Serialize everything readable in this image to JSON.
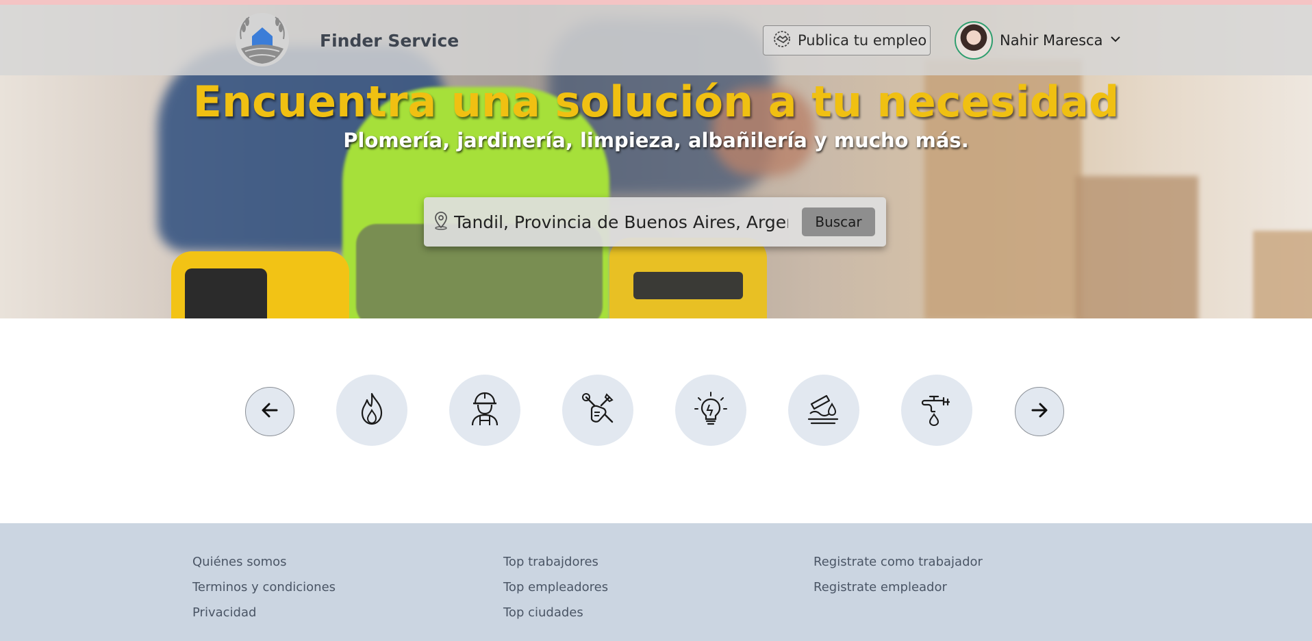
{
  "navbar": {
    "brand": "Finder Service",
    "publish_label": "Publica tu empleo",
    "user_name": "Nahir Maresca"
  },
  "hero": {
    "headline": "Encuentra una solución a tu necesidad",
    "subline": "Plomería, jardinería, limpieza, albañilería y mucho más."
  },
  "search": {
    "value": "Tandil, Provincia de Buenos Aires, Argentina",
    "button_label": "Buscar"
  },
  "categories": [
    {
      "icon": "fire-icon"
    },
    {
      "icon": "worker-icon"
    },
    {
      "icon": "tools-icon"
    },
    {
      "icon": "lightbulb-icon"
    },
    {
      "icon": "cleaning-icon"
    },
    {
      "icon": "faucet-icon"
    }
  ],
  "footer": {
    "col1": [
      "Quiénes somos",
      "Terminos y condiciones",
      "Privacidad"
    ],
    "col2": [
      "Top trabajdores",
      "Top empleadores",
      "Top ciudades"
    ],
    "col3": [
      "Registrate como trabajador",
      "Registrate empleador"
    ]
  },
  "colors": {
    "headline": "#f0c012",
    "footer_bg": "#cbd5e1",
    "category_bg": "#e2e8f0",
    "logo_house": "#3b7dd8"
  }
}
